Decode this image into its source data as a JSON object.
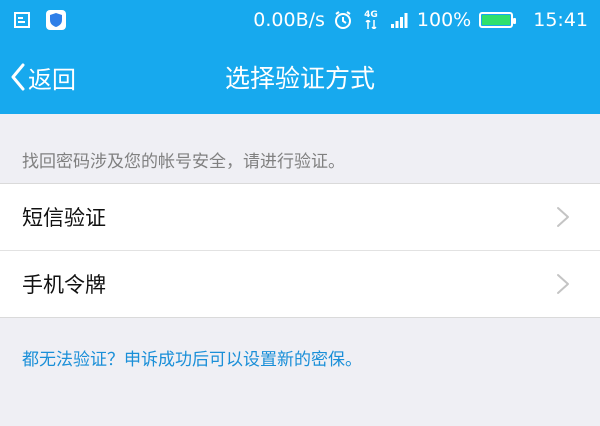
{
  "status_bar": {
    "net_speed": "0.00B/s",
    "network_type": "4G",
    "battery_percent": "100%",
    "battery_level": 1.0,
    "time": "15:41",
    "left_icons": [
      "notification-icon",
      "shield-app-icon"
    ],
    "right_icons": [
      "alarm-icon",
      "network-4g-icon",
      "signal-icon",
      "battery-icon"
    ]
  },
  "nav": {
    "back_label": "返回",
    "title": "选择验证方式"
  },
  "hint": "找回密码涉及您的帐号安全，请进行验证。",
  "options": [
    {
      "label": "短信验证"
    },
    {
      "label": "手机令牌"
    }
  ],
  "help_link": "都无法验证？申诉成功后可以设置新的密保。",
  "colors": {
    "accent": "#17a9ee",
    "background": "#efeff4",
    "link": "#1a8fd8",
    "battery_fill": "#2fe06b"
  }
}
